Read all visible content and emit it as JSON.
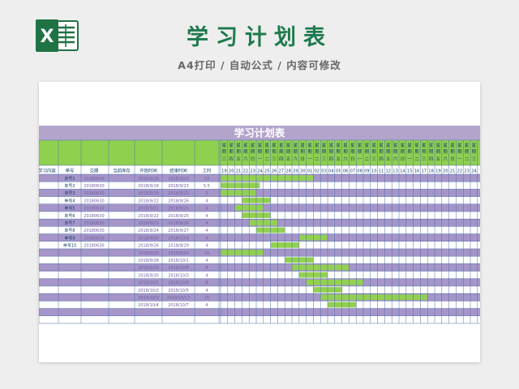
{
  "header": {
    "app_icon": "excel-icon",
    "logo_letter": "X",
    "title": "学习计划表",
    "subtitle": "A4打印 / 自动公式 / 内容可修改"
  },
  "sheet": {
    "title": "学习计划表",
    "columns": [
      "学习内容",
      "单号",
      "交期",
      "当前库存",
      "开始时间",
      "结束时间",
      "工时"
    ],
    "day_numbers": [
      "19",
      "20",
      "21",
      "22",
      "23",
      "24",
      "25",
      "26",
      "27",
      "28",
      "29",
      "30",
      "01",
      "02",
      "03",
      "04",
      "05",
      "06",
      "07",
      "08",
      "09",
      "10",
      "11",
      "12",
      "13",
      "14",
      "15",
      "16",
      "17",
      "18",
      "19",
      "20",
      "21",
      "22",
      "23",
      "24"
    ],
    "weekdays": [
      "三",
      "四",
      "五",
      "六",
      "日",
      "一",
      "二",
      "三",
      "四",
      "五",
      "六",
      "日",
      "一",
      "二",
      "三",
      "四",
      "五",
      "六",
      "日",
      "一",
      "二",
      "三",
      "四",
      "五",
      "六",
      "日",
      "一",
      "二",
      "三",
      "四",
      "五",
      "六",
      "日",
      "一",
      "二",
      "三"
    ],
    "week_label_top": "星",
    "week_label_mid": "期",
    "rows": [
      {
        "content": "",
        "order": "单号1",
        "due": "20180630",
        "stock": "",
        "start": "2018/9/18",
        "end": "2018/10/1",
        "hours": "13",
        "bar_start": 0,
        "bar_len": 13
      },
      {
        "content": "",
        "order": "单号2",
        "due": "20180630",
        "stock": "",
        "start": "2018/9/18",
        "end": "2018/9/23",
        "hours": "5.5",
        "bar_start": 0,
        "bar_len": 5.5
      },
      {
        "content": "",
        "order": "单号3",
        "due": "20180630",
        "stock": "",
        "start": "2018/9/19",
        "end": "2018/9/23",
        "hours": "5",
        "bar_start": 0,
        "bar_len": 5
      },
      {
        "content": "",
        "order": "单号4",
        "due": "20180630",
        "stock": "",
        "start": "2018/9/22",
        "end": "2018/9/26",
        "hours": "4",
        "bar_start": 3,
        "bar_len": 4
      },
      {
        "content": "",
        "order": "单号5",
        "due": "20180630",
        "stock": "",
        "start": "2018/9/21",
        "end": "2018/9/24",
        "hours": "4",
        "bar_start": 2,
        "bar_len": 4
      },
      {
        "content": "",
        "order": "单号6",
        "due": "20180630",
        "stock": "",
        "start": "2018/9/22",
        "end": "2018/9/25",
        "hours": "4",
        "bar_start": 3,
        "bar_len": 4
      },
      {
        "content": "",
        "order": "单号7",
        "due": "20180630",
        "stock": "",
        "start": "2018/9/23",
        "end": "2018/9/26",
        "hours": "4",
        "bar_start": 4,
        "bar_len": 4
      },
      {
        "content": "",
        "order": "单号8",
        "due": "20180630",
        "stock": "",
        "start": "2018/9/24",
        "end": "2018/9/27",
        "hours": "4",
        "bar_start": 5,
        "bar_len": 4
      },
      {
        "content": "",
        "order": "单号9",
        "due": "20180630",
        "stock": "",
        "start": "2018/9/30",
        "end": "2018/10/3",
        "hours": "4",
        "bar_start": 11,
        "bar_len": 4
      },
      {
        "content": "",
        "order": "单号10",
        "due": "20180630",
        "stock": "",
        "start": "2018/9/26",
        "end": "2018/9/29",
        "hours": "4",
        "bar_start": 7,
        "bar_len": 4
      },
      {
        "content": "",
        "order": "",
        "due": "",
        "stock": "",
        "start": "2018/9/15",
        "end": "2018/9/24",
        "hours": "10",
        "bar_start": 0,
        "bar_len": 6
      },
      {
        "content": "",
        "order": "",
        "due": "",
        "stock": "",
        "start": "2018/9/28",
        "end": "2018/10/1",
        "hours": "4",
        "bar_start": 9,
        "bar_len": 4
      },
      {
        "content": "",
        "order": "",
        "due": "",
        "stock": "",
        "start": "2018/9/29",
        "end": "2018/10/6",
        "hours": "8",
        "bar_start": 10,
        "bar_len": 8
      },
      {
        "content": "",
        "order": "",
        "due": "",
        "stock": "",
        "start": "2018/9/30",
        "end": "2018/10/3",
        "hours": "4",
        "bar_start": 11,
        "bar_len": 4
      },
      {
        "content": "",
        "order": "",
        "due": "",
        "stock": "",
        "start": "2018/10/1",
        "end": "2018/10/8",
        "hours": "8",
        "bar_start": 12,
        "bar_len": 8
      },
      {
        "content": "",
        "order": "",
        "due": "",
        "stock": "",
        "start": "2018/10/2",
        "end": "2018/10/5",
        "hours": "4",
        "bar_start": 13,
        "bar_len": 4
      },
      {
        "content": "",
        "order": "",
        "due": "",
        "stock": "",
        "start": "2018/10/3",
        "end": "2018/10/17",
        "hours": "15",
        "bar_start": 14,
        "bar_len": 15
      },
      {
        "content": "",
        "order": "",
        "due": "",
        "stock": "",
        "start": "2018/10/4",
        "end": "2018/10/7",
        "hours": "4",
        "bar_start": 15,
        "bar_len": 4
      },
      {
        "content": "",
        "order": "",
        "due": "",
        "stock": "",
        "start": "",
        "end": "",
        "hours": "",
        "bar_start": null,
        "bar_len": 0
      },
      {
        "content": "",
        "order": "",
        "due": "",
        "stock": "",
        "start": "",
        "end": "",
        "hours": "",
        "bar_start": null,
        "bar_len": 0
      }
    ]
  },
  "colors": {
    "title_green": "#1d7a4d",
    "excel_green": "#1f7244",
    "header_purple": "#b3a4cc",
    "header_green": "#8fd14f",
    "row_purple": "#a595c9",
    "bar_green": "#92d050",
    "grid_line": "#4f6fa8",
    "header_text": "#16406b",
    "date_text": "#6f5fa1"
  }
}
